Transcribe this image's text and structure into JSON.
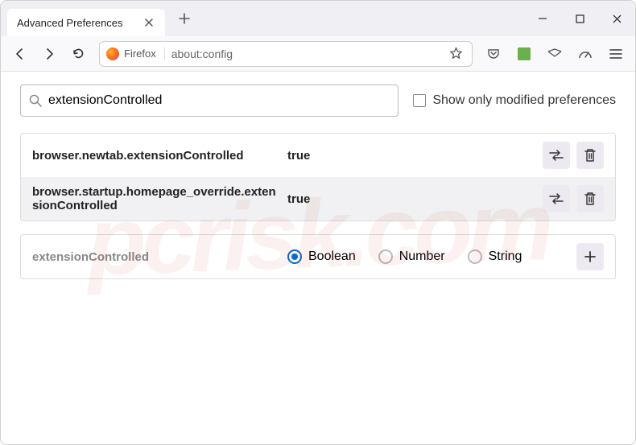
{
  "tab": {
    "title": "Advanced Preferences"
  },
  "urlbar": {
    "identity_label": "Firefox",
    "url": "about:config"
  },
  "search": {
    "value": "extensionControlled"
  },
  "filter": {
    "modified_only_label": "Show only modified preferences"
  },
  "prefs": [
    {
      "name": "browser.newtab.extensionControlled",
      "value": "true"
    },
    {
      "name": "browser.startup.homepage_override.extensionControlled",
      "value": "true"
    }
  ],
  "newpref": {
    "name": "extensionControlled",
    "types": {
      "boolean": "Boolean",
      "number": "Number",
      "string": "String"
    }
  },
  "watermark": "pcrisk.com"
}
